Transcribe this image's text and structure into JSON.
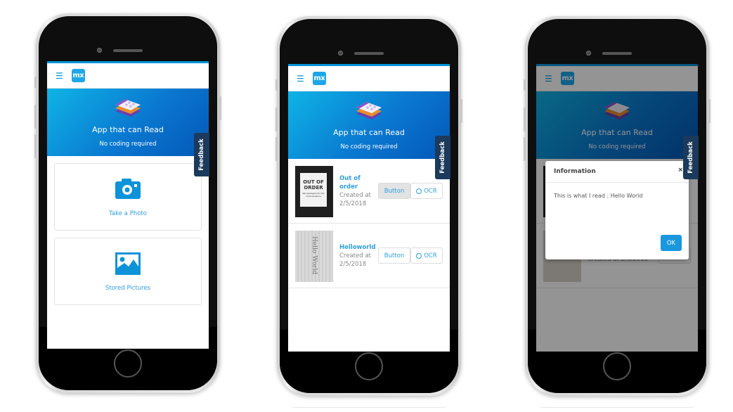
{
  "app": {
    "menu_icon": "hamburger-icon",
    "logo_text": "mx",
    "banner_title": "App that can Read",
    "banner_subtitle": "No coding required",
    "feedback_label": "Feedback"
  },
  "colors": {
    "accent": "#0595db",
    "link": "#2f9ee0",
    "feedback_tab": "#1b3a5c",
    "banner_start": "#0fb4e6",
    "banner_end": "#0457b7",
    "ok_button": "#1a97dd"
  },
  "screen1": {
    "tiles": [
      {
        "label": "Take a Photo",
        "icon": "camera-icon"
      },
      {
        "label": "Stored Pictures",
        "icon": "image-icon"
      }
    ]
  },
  "screen2": {
    "items": [
      {
        "name_line1": "Out of",
        "name_line2": "order",
        "created_label": "Created at",
        "date": "2/5/2018",
        "thumb_text_1": "OUT OF",
        "thumb_text_2": "ORDER",
        "thumb_small": "We apologize for the inconvenience",
        "button_label": "Button",
        "ocr_label": "OCR"
      },
      {
        "name_line1": "Helloworld",
        "created_label": "Created at",
        "date": "2/5/2018",
        "thumb_text": "Hello World",
        "button_label": "Button",
        "ocr_label": "OCR"
      }
    ]
  },
  "screen3": {
    "dialog": {
      "title": "Information",
      "close_label": "×",
      "message": "This is what I read : Hello World",
      "ok_label": "OK"
    },
    "behind_item_text": "Created at 2/5/2018",
    "behind_ocr_label": "OCR"
  }
}
